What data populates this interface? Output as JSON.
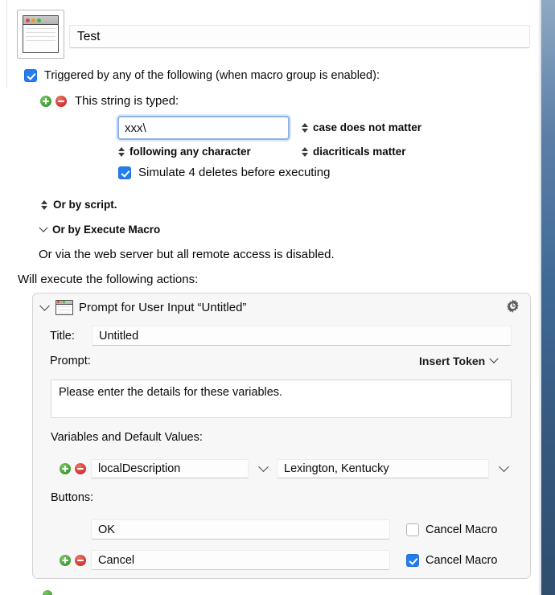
{
  "macro": {
    "icon": "mini-window-icon",
    "name_value": "Test"
  },
  "trigger": {
    "enabled_label": "Triggered by any of the following (when macro group is enabled):",
    "enabled_checked": true,
    "add_icon": "add-circle-icon",
    "remove_icon": "remove-circle-icon",
    "type_label": "This string is typed:",
    "typed_value": "xxx\\",
    "case_option": "case does not matter",
    "following_option": "following any character",
    "diacriticals_option": "diacriticals matter",
    "simulate_label": "Simulate 4 deletes before executing",
    "simulate_checked": true,
    "script_option": "Or by script.",
    "execute_macro_option": "Or by Execute Macro",
    "web_server_note": "Or via the web server but all remote access is disabled."
  },
  "actions": {
    "header_label": "Will execute the following actions:",
    "panel": {
      "disclosure_icon": "chevron-down-icon",
      "action_icon": "prompt-window-icon",
      "title": "Prompt for User Input “Untitled”",
      "gear_icon": "gear-clock-icon",
      "title_label": "Title:",
      "title_value": "Untitled",
      "prompt_label": "Prompt:",
      "insert_token_label": "Insert Token",
      "insert_token_icon": "chevron-down-icon",
      "prompt_text": "Please enter the details for these variables.",
      "variables_label": "Variables and Default Values:",
      "variables": [
        {
          "name": "localDescription",
          "default": "Lexington, Kentucky",
          "add_icon": "add-circle-icon",
          "remove_icon": "remove-circle-icon"
        }
      ],
      "buttons_label": "Buttons:",
      "buttons": [
        {
          "label": "OK",
          "cancel_macro_label": "Cancel Macro",
          "cancel_macro_checked": false,
          "has_add_remove": false
        },
        {
          "label": "Cancel",
          "cancel_macro_label": "Cancel Macro",
          "cancel_macro_checked": true,
          "has_add_remove": true
        }
      ]
    }
  },
  "colors": {
    "accent_blue": "#247cf0",
    "panel_bg": "#f7f7f7",
    "add_green": "#3f9c36",
    "remove_red": "#cf322c",
    "focus_ring": "#8cb4ea"
  }
}
